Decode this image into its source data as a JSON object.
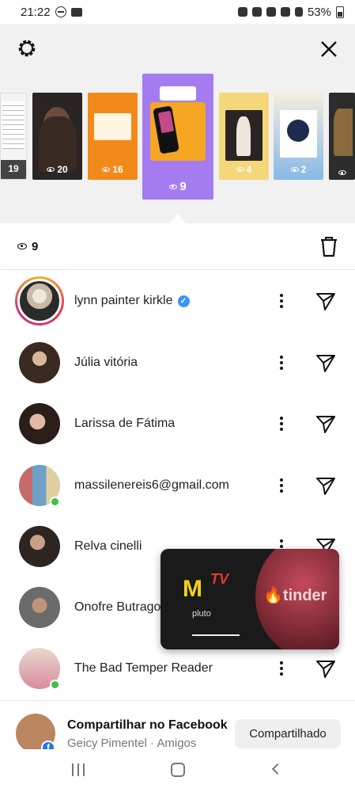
{
  "status_bar": {
    "time": "21:22",
    "battery": "53%"
  },
  "story_tray": {
    "stories": [
      {
        "views": "19",
        "thumb": "text-post"
      },
      {
        "views": "20",
        "thumb": "portrait-dark"
      },
      {
        "views": "16",
        "thumb": "orange-text"
      },
      {
        "views": "9",
        "thumb": "phone-music",
        "active": true
      },
      {
        "views": "4",
        "thumb": "yellow-photo"
      },
      {
        "views": "2",
        "thumb": "blue-card"
      },
      {
        "views": "",
        "thumb": "dark-partial"
      }
    ]
  },
  "views_header": {
    "count": "9"
  },
  "viewers": [
    {
      "name": "lynn painter kirkle",
      "verified": true,
      "ring": true,
      "online": false
    },
    {
      "name": "Júlia vitória",
      "verified": false,
      "ring": false,
      "online": false
    },
    {
      "name": "Larissa de Fátima",
      "verified": false,
      "ring": false,
      "online": false
    },
    {
      "name": "massilenereis6@gmail.com",
      "verified": false,
      "ring": false,
      "online": true
    },
    {
      "name": "Relva cinelli",
      "verified": false,
      "ring": false,
      "online": false
    },
    {
      "name": "Onofre Butrago",
      "verified": false,
      "ring": false,
      "online": false
    },
    {
      "name": "The Bad Temper Reader",
      "verified": false,
      "ring": false,
      "online": true
    }
  ],
  "pip_overlay": {
    "left_brand": "pluto",
    "right_brand": "tinder"
  },
  "share": {
    "title": "Compartilhar no Facebook",
    "subtitle": "Geicy Pimentel · Amigos",
    "button_label": "Compartilhado"
  },
  "colors": {
    "accent_purple": "#a57cf0",
    "verified_blue": "#3897f0",
    "online_green": "#3ec04a",
    "facebook_blue": "#1877f2"
  }
}
